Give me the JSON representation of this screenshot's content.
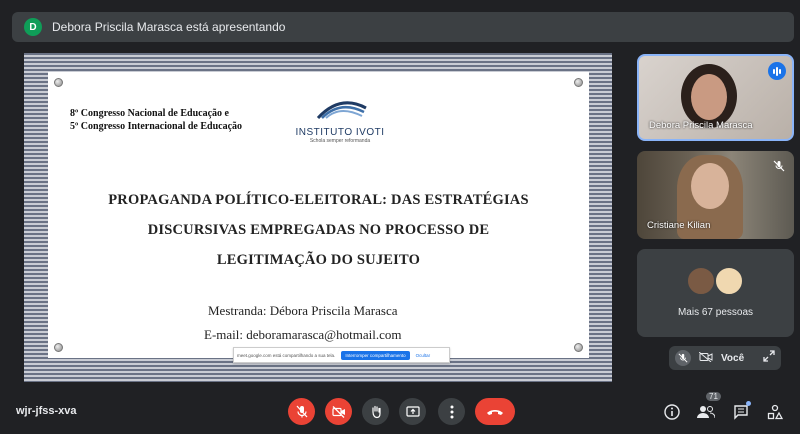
{
  "banner": {
    "initial": "D",
    "text": "Debora Priscila Marasca está apresentando"
  },
  "slide": {
    "congress_line1": "8º Congresso Nacional de Educação e",
    "congress_line2": "5º Congresso Internacional de Educação",
    "logo_name": "INSTITUTO IVOTI",
    "logo_tagline": "Schola semper reformanda",
    "title_line1": "PROPAGANDA POLÍTICO-ELEITORAL: DAS ESTRATÉGIAS",
    "title_line2": "DISCURSIVAS EMPREGADAS NO PROCESSO DE",
    "title_line3": "LEGITIMAÇÃO DO SUJEITO",
    "author": "Mestranda: Débora Priscila Marasca",
    "email": "E-mail: deboramarasca@hotmail.com"
  },
  "share_bar": {
    "message": "meet.google.com está compartilhando a sua tela.",
    "stop_label": "Interromper compartilhamento",
    "hide_label": "Ocultar"
  },
  "participants": [
    {
      "name": "Debora Priscila Marasca",
      "speaking": true
    },
    {
      "name": "Cristiane Kilian",
      "muted": true
    }
  ],
  "more_people": "Mais 67 pessoas",
  "self_view": {
    "label": "Você"
  },
  "bottom": {
    "meeting_code": "wjr-jfss-xva",
    "people_count": "71"
  },
  "colors": {
    "background": "#202124",
    "tile": "#3c4043",
    "danger": "#ea4335",
    "accent": "#8ab4f8"
  },
  "icons": [
    "mic-off-icon",
    "camera-off-icon",
    "raise-hand-icon",
    "present-icon",
    "more-options-icon",
    "leave-call-icon",
    "info-icon",
    "people-icon",
    "chat-icon",
    "activities-icon",
    "expand-icon"
  ]
}
